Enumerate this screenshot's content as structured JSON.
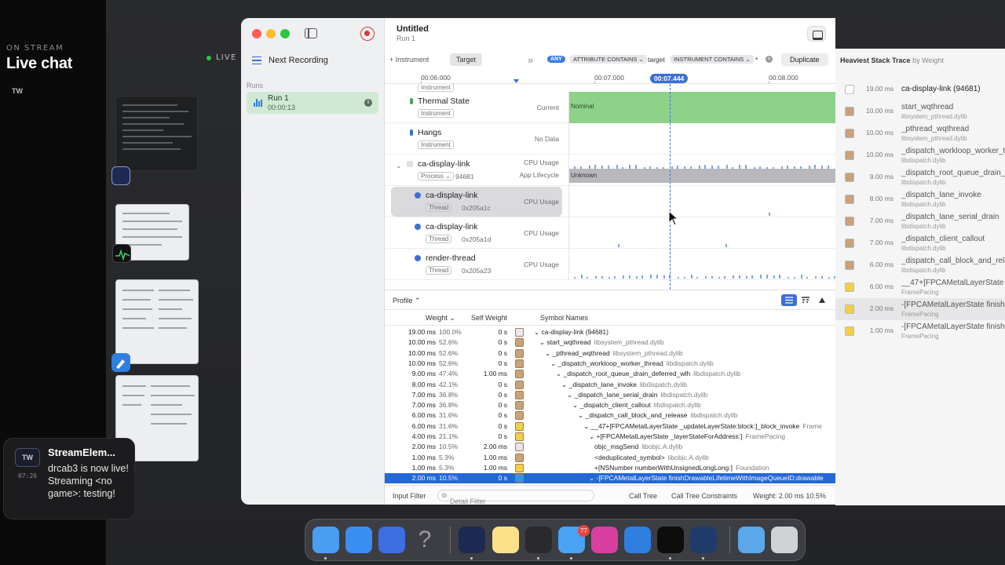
{
  "stream": {
    "on_stream": "ON STREAM",
    "title": "Live chat",
    "live_label": "LIVE",
    "tw": "TW"
  },
  "notification": {
    "avatar": "TW",
    "app": "StreamElem...",
    "body": "drcab3 is now live! Streaming <no game>: testing!",
    "time": "07:26"
  },
  "window": {
    "title": "Untitled",
    "subtitle": "Run 1",
    "sidebar": {
      "next_recording": "Next Recording",
      "runs_label": "Runs",
      "run_title": "Run 1",
      "run_time": "00:00:13"
    },
    "toolbar": {
      "add_instrument": "+ Instrument",
      "target": "Target",
      "any": "ANY",
      "filter1": "ATTRIBUTE CONTAINS ⌄",
      "filter1_value": "target",
      "filter2": "INSTRUMENT CONTAINS ⌄",
      "filter2_value": "*",
      "duplicate": "Duplicate"
    },
    "ruler": {
      "t1": "00:06.000",
      "t2": "00:07.000",
      "t3": "00:07.444",
      "t4": "00:08.000"
    },
    "tracks": [
      {
        "name": "Thermal State",
        "tag": "Instrument",
        "right": "Current",
        "graph_label": "Nominal"
      },
      {
        "name": "Hangs",
        "tag": "Instrument",
        "right": "No Data"
      },
      {
        "name": "ca-display-link",
        "tag": "Process ⌄",
        "sub": "94681",
        "right": "CPU Usage",
        "right2": "App Lifecycle",
        "graph_label": "Unknown"
      },
      {
        "name": "ca-display-link",
        "tag": "Thread",
        "sub": "0x205a1c",
        "right": "CPU Usage"
      },
      {
        "name": "ca-display-link",
        "tag": "Thread",
        "sub": "0x205a1d",
        "right": "CPU Usage"
      },
      {
        "name": "render-thread",
        "tag": "Thread",
        "sub": "0x205a23",
        "right": "CPU Usage"
      }
    ],
    "instrument_above": "Instrument",
    "profile": "Profile ⌃",
    "columns": {
      "weight": "Weight ⌄",
      "self_weight": "Self Weight",
      "symbols": "Symbol Names"
    },
    "rows": [
      {
        "w": "19.00 ms",
        "p": "100.0%",
        "sw": "0 s",
        "sym": "⌄ ca-display-link (94681)",
        "lib": ""
      },
      {
        "w": "10.00 ms",
        "p": "52.6%",
        "sw": "0 s",
        "sym": "⌄ start_wqthread",
        "lib": "libsystem_pthread.dylib"
      },
      {
        "w": "10.00 ms",
        "p": "52.6%",
        "sw": "0 s",
        "sym": "⌄ _pthread_wqthread",
        "lib": "libsystem_pthread.dylib"
      },
      {
        "w": "10.00 ms",
        "p": "52.6%",
        "sw": "0 s",
        "sym": "⌄ _dispatch_workloop_worker_thread",
        "lib": "libdispatch.dylib"
      },
      {
        "w": "9.00 ms",
        "p": "47.4%",
        "sw": "1.00 ms",
        "sym": "⌄ _dispatch_root_queue_drain_deferred_wlh",
        "lib": "libdispatch.dylib"
      },
      {
        "w": "8.00 ms",
        "p": "42.1%",
        "sw": "0 s",
        "sym": "⌄ _dispatch_lane_invoke",
        "lib": "libdispatch.dylib"
      },
      {
        "w": "7.00 ms",
        "p": "36.8%",
        "sw": "0 s",
        "sym": "⌄ _dispatch_lane_serial_drain",
        "lib": "libdispatch.dylib"
      },
      {
        "w": "7.00 ms",
        "p": "36.8%",
        "sw": "0 s",
        "sym": "⌄ _dispatch_client_callout",
        "lib": "libdispatch.dylib"
      },
      {
        "w": "6.00 ms",
        "p": "31.6%",
        "sw": "0 s",
        "sym": "⌄ _dispatch_call_block_and_release",
        "lib": "libdispatch.dylib"
      },
      {
        "w": "6.00 ms",
        "p": "31.6%",
        "sw": "0 s",
        "sym": "⌄ __47+[FPCAMetalLayerState _updateLayerState:block:]_block_invoke",
        "lib": "Frame"
      },
      {
        "w": "4.00 ms",
        "p": "21.1%",
        "sw": "0 s",
        "sym": "⌄ +[FPCAMetalLayerState _layerStateForAddress:]",
        "lib": "FramePacing"
      },
      {
        "w": "2.00 ms",
        "p": "10.5%",
        "sw": "2.00 ms",
        "sym": "objc_msgSend",
        "lib": "libobjc.A.dylib"
      },
      {
        "w": "1.00 ms",
        "p": "5.3%",
        "sw": "1.00 ms",
        "sym": "<deduplicated_symbol>",
        "lib": "libobjc.A.dylib"
      },
      {
        "w": "1.00 ms",
        "p": "5.3%",
        "sw": "1.00 ms",
        "sym": "+[NSNumber numberWithUnsignedLongLong:]",
        "lib": "Foundation"
      },
      {
        "w": "2.00 ms",
        "p": "10.5%",
        "sw": "0 s",
        "sym": "⌄ -[FPCAMetalLayerState finishDrawableLifetimeWithImageQueueID:drawable",
        "lib": ""
      }
    ],
    "bottom": {
      "input_filter": "Input Filter",
      "detail_filter": "Detail Filter",
      "call_tree": "Call Tree",
      "constraints": "Call Tree Constraints",
      "weight": "Weight: 2.00 ms  10.5%"
    }
  },
  "inspector": {
    "title": "Heaviest Stack Trace",
    "by": "by Weight",
    "frames": [
      {
        "ms": "19.00 ms",
        "fn": "ca-display-link (94681)",
        "fl": ""
      },
      {
        "ms": "10.00 ms",
        "fn": "start_wqthread",
        "fl": "libsystem_pthread.dylib"
      },
      {
        "ms": "10.00 ms",
        "fn": "_pthread_wqthread",
        "fl": "libsystem_pthread.dylib"
      },
      {
        "ms": "10.00 ms",
        "fn": "_dispatch_workloop_worker_th",
        "fl": "libdispatch.dylib"
      },
      {
        "ms": "9.00 ms",
        "fn": "_dispatch_root_queue_drain_de",
        "fl": "libdispatch.dylib"
      },
      {
        "ms": "8.00 ms",
        "fn": "_dispatch_lane_invoke",
        "fl": "libdispatch.dylib"
      },
      {
        "ms": "7.00 ms",
        "fn": "_dispatch_lane_serial_drain",
        "fl": "libdispatch.dylib"
      },
      {
        "ms": "7.00 ms",
        "fn": "_dispatch_client_callout",
        "fl": "libdispatch.dylib"
      },
      {
        "ms": "6.00 ms",
        "fn": "_dispatch_call_block_and_rele",
        "fl": "libdispatch.dylib"
      },
      {
        "ms": "6.00 ms",
        "fn": "__47+[FPCAMetalLayerState _",
        "fl": "FramePacing"
      },
      {
        "ms": "2.00 ms",
        "fn": "-[FPCAMetalLayerState finish",
        "fl": "FramePacing"
      },
      {
        "ms": "1.00 ms",
        "fn": "-[FPCAMetalLayerState finish",
        "fl": "FramePacing"
      }
    ]
  },
  "dock": {
    "mail_badge": "77",
    "icons": [
      "finder-icon",
      "safari-icon",
      "simulator-icon",
      "help-icon",
      "instruments-icon",
      "notes-icon",
      "hammer-icon",
      "mail-icon",
      "star-app-icon",
      "xcode-beta-icon",
      "activity-monitor-icon",
      "instruments-beta-icon",
      "folder-icon",
      "trash-icon"
    ]
  }
}
